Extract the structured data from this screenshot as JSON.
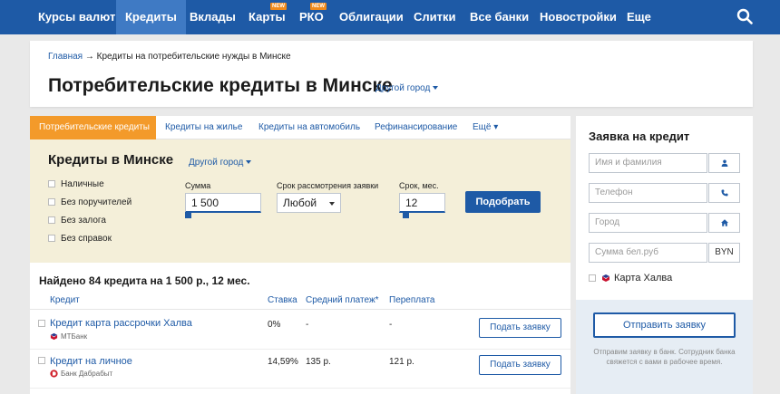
{
  "nav": {
    "items": [
      {
        "label": "Курсы валют",
        "badge": ""
      },
      {
        "label": "Кредиты",
        "badge": ""
      },
      {
        "label": "Вклады",
        "badge": ""
      },
      {
        "label": "Карты",
        "badge": "NEW"
      },
      {
        "label": "РКО",
        "badge": "NEW"
      },
      {
        "label": "Облигации",
        "badge": ""
      },
      {
        "label": "Слитки",
        "badge": ""
      },
      {
        "label": "Все банки",
        "badge": ""
      },
      {
        "label": "Новостройки",
        "badge": ""
      },
      {
        "label": "Еще",
        "badge": ""
      }
    ],
    "active_index": 1,
    "search_icon": "search-icon"
  },
  "header": {
    "breadcrumb_home": "Главная",
    "breadcrumb_sep": "→",
    "breadcrumb_current": "Кредиты на потребительские нужды в Минске",
    "title": "Потребительские кредиты в Минске",
    "city_link": "Другой город"
  },
  "tabs": [
    {
      "label": "Потребительские кредиты"
    },
    {
      "label": "Кредиты на жилье"
    },
    {
      "label": "Кредиты на автомобиль"
    },
    {
      "label": "Рефинансирование"
    },
    {
      "label": "Ещё ▾"
    }
  ],
  "filter": {
    "title": "Кредиты в Минске",
    "city_link": "Другой город",
    "checkboxes": [
      "Наличные",
      "Без поручителей",
      "Без залога",
      "Без справок"
    ],
    "amount_label": "Сумма",
    "amount_value": "1 500",
    "review_label": "Срок рассмотрения заявки",
    "review_value": "Любой",
    "term_label": "Срок, мес.",
    "term_value": "12",
    "submit_label": "Подобрать"
  },
  "results": {
    "title": "Найдено 84 кредита на 1 500 р., 12 мес.",
    "columns": [
      "Кредит",
      "Ставка",
      "Средний платеж*",
      "Переплата"
    ],
    "rows": [
      {
        "name": "Кредит карта рассрочки Халва",
        "bank": "МТБанк",
        "rate": "0%",
        "payment": "-",
        "overpay": "-",
        "button": "Подать заявку"
      },
      {
        "name": "Кредит на личное",
        "bank": "Банк Дабрабыт",
        "rate": "14,59%",
        "payment": "135 р.",
        "overpay": "121 р.",
        "button": "Подать заявку"
      }
    ]
  },
  "side": {
    "title": "Заявка на кредит",
    "name_placeholder": "Имя и фамилия",
    "phone_placeholder": "Телефон",
    "city_placeholder": "Город",
    "sum_placeholder": "Сумма бел.руб",
    "currency": "BYN",
    "halva_label": "Карта Халва",
    "submit_label": "Отправить заявку",
    "note": "Отправим заявку в банк. Сотрудник банка свяжется с вами в рабочее время."
  },
  "colors": {
    "nav_bg": "#1e5aa6",
    "nav_active": "#3f7ac4",
    "tab_active": "#f39a2a",
    "filter_bg": "#f4efd9",
    "accent": "#1e5aa6"
  }
}
